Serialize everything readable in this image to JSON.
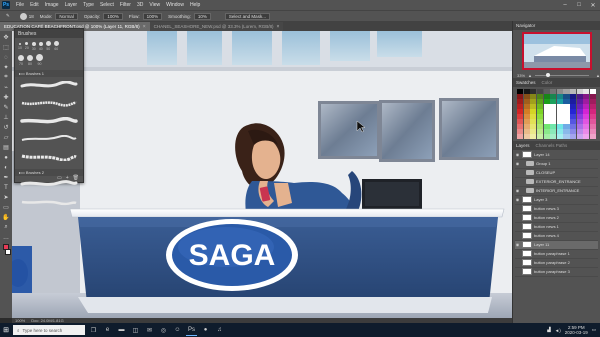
{
  "app": {
    "logo": "Ps",
    "menu": [
      "File",
      "Edit",
      "Image",
      "Layer",
      "Type",
      "Select",
      "Filter",
      "3D",
      "View",
      "Window",
      "Help"
    ],
    "window_controls": [
      "–",
      "□",
      "✕"
    ]
  },
  "options_bar": {
    "brush_size": "18",
    "mode_label": "Mode:",
    "mode_value": "Normal",
    "opacity_label": "Opacity:",
    "opacity_value": "100%",
    "flow_label": "Flow:",
    "flow_value": "100%",
    "smoothing_label": "Smoothing:",
    "smoothing_value": "10%",
    "extra_box": "Select and Mask..."
  },
  "tabs": [
    {
      "label": "EDUCATION CAFÉ BEACHFRONT.psd @ 100% (Layer 11, RGB/8)",
      "active": true
    },
    {
      "label": "CHANEL_SEASHORE_NEW.psd @ 33.3% (Lorem, RGB/8)",
      "active": false
    }
  ],
  "brushes_panel": {
    "title": "Brushes",
    "sizes": [
      "10",
      "20",
      "30",
      "40",
      "50",
      "60",
      "70",
      "80",
      "90"
    ],
    "folders": [
      "Brushes 1",
      "Brushes 2"
    ]
  },
  "canvas": {
    "logo_text": "SAGA"
  },
  "status": {
    "zoom": "100%",
    "doc": "Doc: 24.0M/1.81G"
  },
  "right_dock": {
    "navigator_title": "Navigator",
    "zoom_value": "33%",
    "color_title": "Swatches",
    "color_tabs_inactive": "Color",
    "layers_title": "Layers",
    "layers_tabs_inactive": "Channels  Paths",
    "layers": [
      {
        "name": "Layer 14",
        "type": "layer",
        "selected": false
      },
      {
        "name": "Group 1",
        "type": "group",
        "selected": false
      },
      {
        "name": "CLOSEUP",
        "type": "group",
        "selected": false
      },
      {
        "name": "EXTERIOR_ENTRANCE",
        "type": "group",
        "selected": false
      },
      {
        "name": "INTERIOR_ENTRANCE",
        "type": "group",
        "selected": false
      },
      {
        "name": "Layer 3",
        "type": "layer",
        "selected": false
      },
      {
        "name": "button news 3",
        "type": "layer",
        "selected": false
      },
      {
        "name": "button news 2",
        "type": "layer",
        "selected": false
      },
      {
        "name": "button news 1",
        "type": "layer",
        "selected": false
      },
      {
        "name": "button news 4",
        "type": "layer",
        "selected": false
      },
      {
        "name": "Layer 11",
        "type": "layer",
        "selected": true
      },
      {
        "name": "button paraphrase 1",
        "type": "layer",
        "selected": false
      },
      {
        "name": "button paraphrase 2",
        "type": "layer",
        "selected": false
      },
      {
        "name": "button paraphrase 3",
        "type": "layer",
        "selected": false
      }
    ]
  },
  "taskbar": {
    "search_placeholder": "Type here to search",
    "time": "2:59 PM",
    "date": "2020-03-19"
  },
  "colors": {
    "accent_red": "#c8102e",
    "desk_blue": "#2d4e82",
    "logo_blue": "#2a5aa8"
  }
}
